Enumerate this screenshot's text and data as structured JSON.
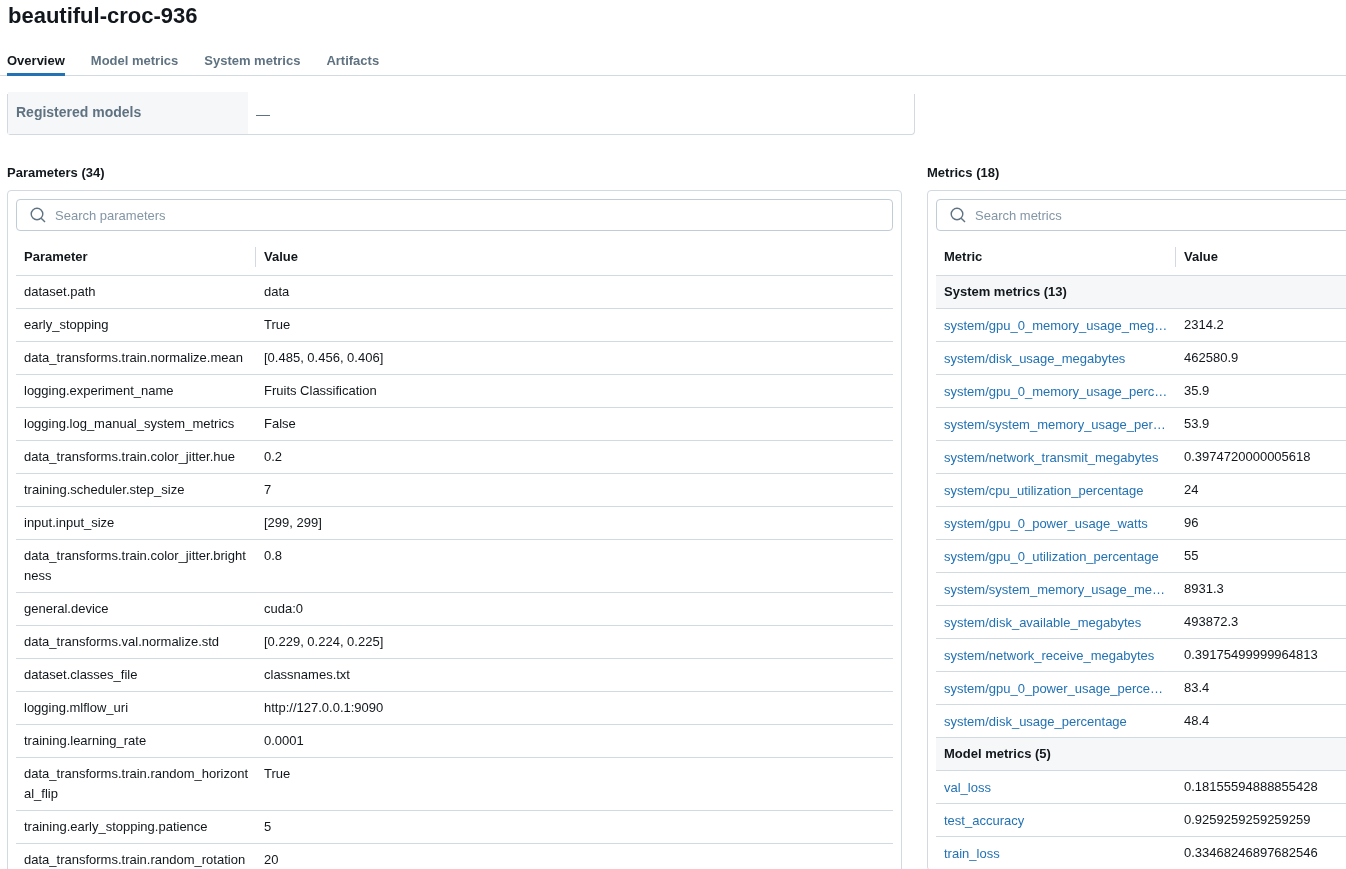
{
  "title": "beautiful-croc-936",
  "tabs": [
    {
      "label": "Overview",
      "selected": true
    },
    {
      "label": "Model metrics",
      "selected": false
    },
    {
      "label": "System metrics",
      "selected": false
    },
    {
      "label": "Artifacts",
      "selected": false
    }
  ],
  "details": [
    {
      "label": "Registered models",
      "value": "—"
    }
  ],
  "parameters": {
    "heading": "Parameters (34)",
    "search_placeholder": "Search parameters",
    "columns": [
      "Parameter",
      "Value"
    ],
    "rows": [
      {
        "name": "dataset.path",
        "value": "data"
      },
      {
        "name": "early_stopping",
        "value": "True"
      },
      {
        "name": "data_transforms.train.normalize.mean",
        "value": "[0.485, 0.456, 0.406]"
      },
      {
        "name": "logging.experiment_name",
        "value": "Fruits Classification"
      },
      {
        "name": "logging.log_manual_system_metrics",
        "value": "False"
      },
      {
        "name": "data_transforms.train.color_jitter.hue",
        "value": "0.2"
      },
      {
        "name": "training.scheduler.step_size",
        "value": "7"
      },
      {
        "name": "input.input_size",
        "value": "[299, 299]"
      },
      {
        "name": "data_transforms.train.color_jitter.brightness",
        "value": "0.8"
      },
      {
        "name": "general.device",
        "value": "cuda:0"
      },
      {
        "name": "data_transforms.val.normalize.std",
        "value": "[0.229, 0.224, 0.225]"
      },
      {
        "name": "dataset.classes_file",
        "value": "classnames.txt"
      },
      {
        "name": "logging.mlflow_uri",
        "value": "http://127.0.0.1:9090"
      },
      {
        "name": "training.learning_rate",
        "value": "0.0001"
      },
      {
        "name": "data_transforms.train.random_horizontal_flip",
        "value": "True"
      },
      {
        "name": "training.early_stopping.patience",
        "value": "5"
      },
      {
        "name": "data_transforms.train.random_rotation",
        "value": "20"
      }
    ]
  },
  "metrics": {
    "heading": "Metrics (18)",
    "search_placeholder": "Search metrics",
    "columns": [
      "Metric",
      "Value"
    ],
    "groups": [
      {
        "title": "System metrics (13)",
        "rows": [
          {
            "name": "system/gpu_0_memory_usage_meg…",
            "value": "2314.2"
          },
          {
            "name": "system/disk_usage_megabytes",
            "value": "462580.9"
          },
          {
            "name": "system/gpu_0_memory_usage_perc…",
            "value": "35.9"
          },
          {
            "name": "system/system_memory_usage_per…",
            "value": "53.9"
          },
          {
            "name": "system/network_transmit_megabytes",
            "value": "0.3974720000005618"
          },
          {
            "name": "system/cpu_utilization_percentage",
            "value": "24"
          },
          {
            "name": "system/gpu_0_power_usage_watts",
            "value": "96"
          },
          {
            "name": "system/gpu_0_utilization_percentage",
            "value": "55"
          },
          {
            "name": "system/system_memory_usage_me…",
            "value": "8931.3"
          },
          {
            "name": "system/disk_available_megabytes",
            "value": "493872.3"
          },
          {
            "name": "system/network_receive_megabytes",
            "value": "0.39175499999964813"
          },
          {
            "name": "system/gpu_0_power_usage_perce…",
            "value": "83.4"
          },
          {
            "name": "system/disk_usage_percentage",
            "value": "48.4"
          }
        ]
      },
      {
        "title": "Model metrics (5)",
        "rows": [
          {
            "name": "val_loss",
            "value": "0.18155594888855428"
          },
          {
            "name": "test_accuracy",
            "value": "0.9259259259259259"
          },
          {
            "name": "train_loss",
            "value": "0.33468246897682546"
          }
        ]
      }
    ]
  }
}
